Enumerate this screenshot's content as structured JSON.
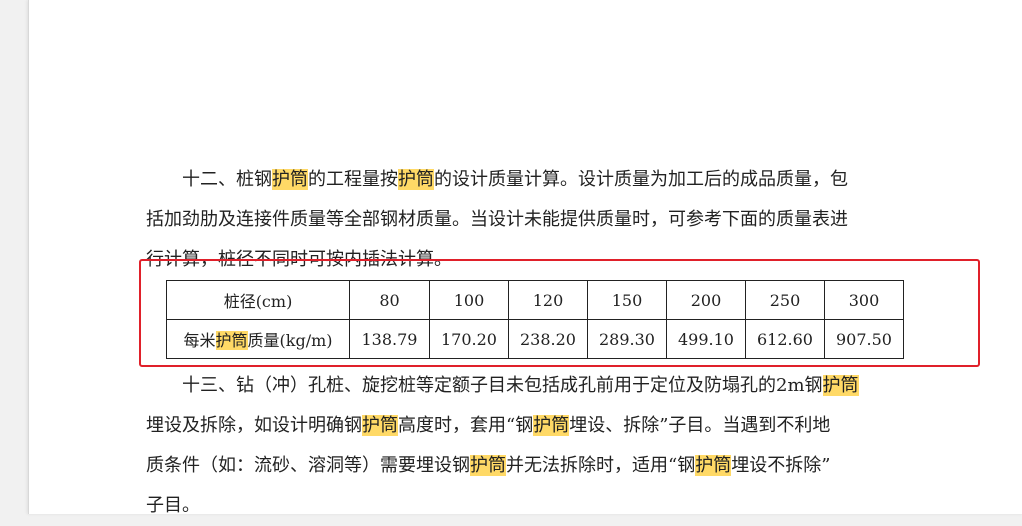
{
  "p12": {
    "line1": [
      "十二、桩钢",
      "护筒",
      "的工程量按",
      "护筒",
      "的设计质量计算。设计质量为加工后的成品质量，包"
    ],
    "line2": "括加劲肋及连接件质量等全部钢材质量。当设计未能提供质量时，可参考下面的质量表进",
    "line3": "行计算，桩径不同时可按内插法计算。"
  },
  "table": {
    "header": [
      "桩径(cm)",
      "80",
      "100",
      "120",
      "150",
      "200",
      "250",
      "300"
    ],
    "row_label_parts": [
      "每米",
      "护筒",
      "质量(kg/m)"
    ],
    "row_values": [
      "138.79",
      "170.20",
      "238.20",
      "289.30",
      "499.10",
      "612.60",
      "907.50"
    ]
  },
  "p13": {
    "line1": [
      "十三、钻（冲）孔桩、旋挖桩等定额子目未包括成孔前用于定位及防塌孔的2m钢",
      "护筒"
    ],
    "line2": [
      "埋设及拆除，如设计明确钢",
      "护筒",
      "高度时，套用“钢",
      "护筒",
      "埋设、拆除”子目。当遇到不利地"
    ],
    "line3": [
      "质条件（如：流砂、溶洞等）需要埋设钢",
      "护筒",
      "并无法拆除时，适用“钢",
      "护筒",
      "埋设不拆除”"
    ],
    "line4": "子目。"
  }
}
